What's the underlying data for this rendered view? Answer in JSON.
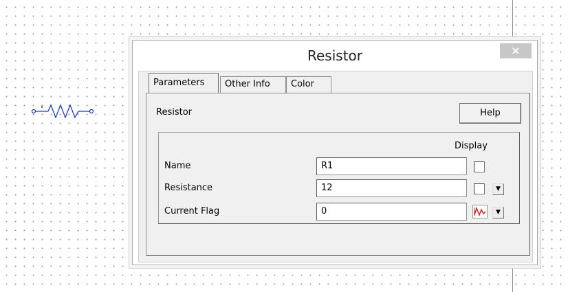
{
  "dialog": {
    "title": "Resistor",
    "close_label": "×"
  },
  "tabs": [
    {
      "label": "Parameters",
      "active": true
    },
    {
      "label": "Other Info",
      "active": false
    },
    {
      "label": "Color",
      "active": false
    }
  ],
  "panel": {
    "heading": "Resistor",
    "help_label": "Help",
    "display_label": "Display",
    "rows": [
      {
        "label": "Name",
        "value": "R1",
        "display_checked": false,
        "has_dropdown": false
      },
      {
        "label": "Resistance",
        "value": "12",
        "display_checked": false,
        "has_dropdown": true
      },
      {
        "label": "Current Flag",
        "value": "0",
        "display_icon": "current-waveform-icon",
        "has_dropdown": true
      }
    ]
  },
  "colors": {
    "resistor_symbol": "#1f3fb8",
    "current_flag_icon": "#c41e1e"
  }
}
